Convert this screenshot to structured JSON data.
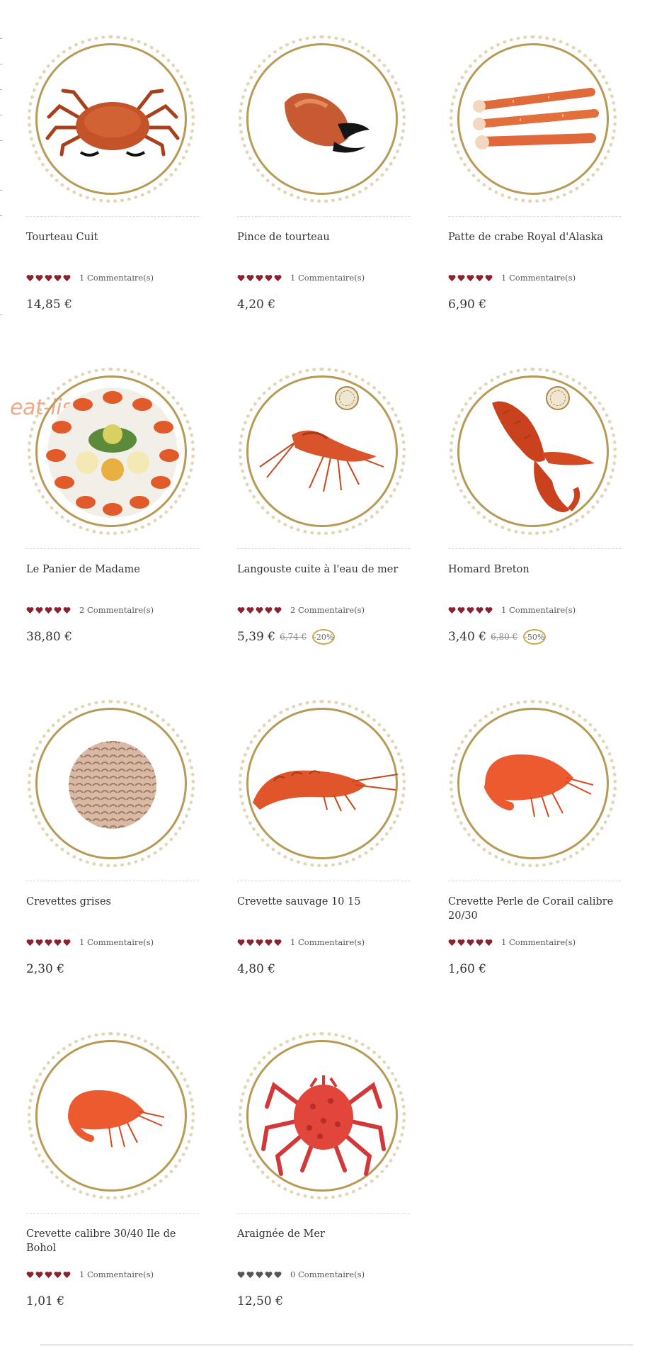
{
  "watermark": "eat-list",
  "products": [
    {
      "name": "Tourteau Cuit",
      "image_icon": "crab-icon",
      "rating": 5,
      "reviews": "1 Commentaire(s)",
      "price": "14,85 €",
      "old_price": "",
      "discount": ""
    },
    {
      "name": "Pince de tourteau",
      "image_icon": "crab-claw-icon",
      "rating": 5,
      "reviews": "1 Commentaire(s)",
      "price": "4,20 €",
      "old_price": "",
      "discount": ""
    },
    {
      "name": "Patte de crabe Royal d'Alaska",
      "image_icon": "king-crab-legs-icon",
      "rating": 5,
      "reviews": "1 Commentaire(s)",
      "price": "6,90 €",
      "old_price": "",
      "discount": ""
    },
    {
      "name": "Le Panier de Madame",
      "image_icon": "seafood-platter-icon",
      "rating": 5,
      "reviews": "2 Commentaire(s)",
      "price": "38,80 €",
      "old_price": "",
      "discount": ""
    },
    {
      "name": "Langouste cuite à l'eau de mer",
      "image_icon": "spiny-lobster-icon",
      "rating": 5,
      "reviews": "2 Commentaire(s)",
      "price": "5,39 €",
      "old_price": "6,74 €",
      "discount": "-20%"
    },
    {
      "name": "Homard Breton",
      "image_icon": "lobster-icon",
      "rating": 5,
      "reviews": "1 Commentaire(s)",
      "price": "3,40 €",
      "old_price": "6,80 €",
      "discount": "-50%"
    },
    {
      "name": "Crevettes grises",
      "image_icon": "grey-shrimp-pile-icon",
      "rating": 5,
      "reviews": "1 Commentaire(s)",
      "price": "2,30 €",
      "old_price": "",
      "discount": ""
    },
    {
      "name": "Crevette sauvage 10 15",
      "image_icon": "wild-prawn-icon",
      "rating": 5,
      "reviews": "1 Commentaire(s)",
      "price": "4,80 €",
      "old_price": "",
      "discount": ""
    },
    {
      "name": "Crevette Perle de Corail calibre 20/30",
      "image_icon": "coral-prawn-icon",
      "rating": 5,
      "reviews": "1 Commentaire(s)",
      "price": "1,60 €",
      "old_price": "",
      "discount": ""
    },
    {
      "name": "Crevette calibre 30/40 Ile de Bohol",
      "image_icon": "bohol-prawn-icon",
      "rating": 5,
      "reviews": "1 Commentaire(s)",
      "price": "1,01 €",
      "old_price": "",
      "discount": ""
    },
    {
      "name": "Araignée de Mer",
      "image_icon": "spider-crab-icon",
      "rating": 0,
      "reviews": "0 Commentaire(s)",
      "price": "12,50 €",
      "old_price": "",
      "discount": ""
    }
  ],
  "colors": {
    "star_filled": "#8b2230",
    "star_empty": "#555555",
    "ring_gold": "#b69a55",
    "seafood_orange": "#e2562a",
    "seafood_dark": "#a83a18"
  }
}
